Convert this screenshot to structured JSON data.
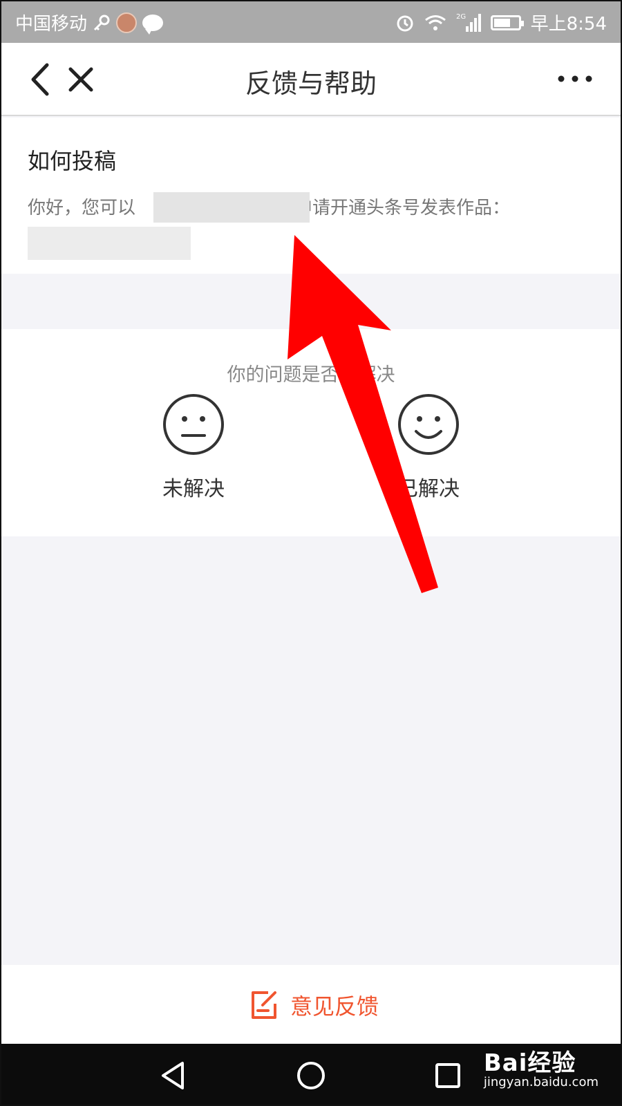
{
  "status_bar": {
    "carrier": "中国移动",
    "network": "2G",
    "time": "早上8:54",
    "icons": [
      "key-icon",
      "app-badge-icon",
      "chat-icon",
      "alarm-icon",
      "wifi-icon",
      "signal-icon",
      "battery-icon"
    ]
  },
  "header": {
    "title": "反馈与帮助",
    "icons": [
      "back-arrow-icon",
      "close-icon",
      "more-icon"
    ]
  },
  "article": {
    "title": "如何投稿",
    "body_start": "你好，您可以",
    "body_end": "申请开通头条号发表作品："
  },
  "feedback": {
    "question": "你的问题是否已解决",
    "options": [
      {
        "label": "未解决",
        "icon": "neutral-face-icon"
      },
      {
        "label": "已解决",
        "icon": "smile-face-icon"
      }
    ]
  },
  "bottom_bar": {
    "feedback_label": "意见反馈",
    "icon": "edit-note-icon",
    "accent_color": "#f0552f"
  },
  "nav_bar": {
    "icons": [
      "nav-back-icon",
      "nav-home-icon",
      "nav-recent-icon"
    ]
  },
  "watermark": {
    "logo_text": "Bai经验",
    "url": "jingyan.baidu.com"
  },
  "annotation": {
    "arrow_color": "#ff0000"
  }
}
